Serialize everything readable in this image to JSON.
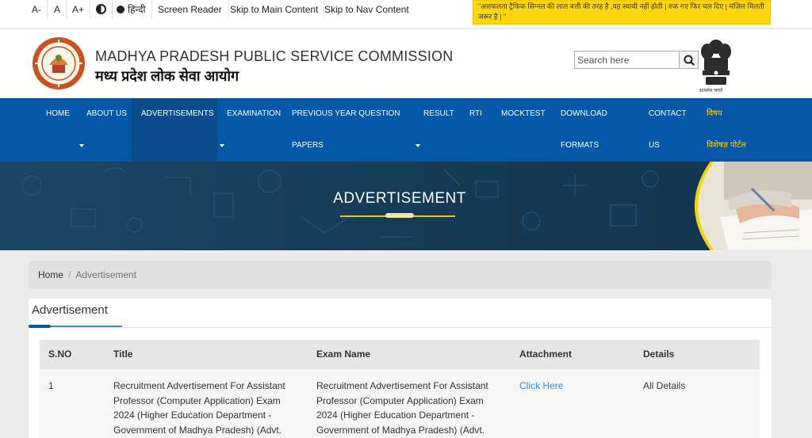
{
  "topbar": {
    "font_smaller": "A-",
    "font_normal": "A",
    "font_larger": "A+",
    "language": "हिन्दी",
    "screen_reader": "Screen Reader",
    "skip_main": "Skip to Main Content",
    "skip_nav": "Skip to Nav Content",
    "quote": "\"असफलता ट्रैफिक सिग्नल की लाल बत्ती की तरह है ,यह स्थायी नहीं होती | रुक गए फिर चल दिए | मंज़िल मिलती जरूर है | \""
  },
  "header": {
    "org_name_en": "MADHYA PRADESH PUBLIC SERVICE COMMISSION",
    "org_name_hi": "मध्य प्रदेश लोक सेवा आयोग",
    "search_placeholder": "Search here",
    "emblem_motto": "सत्यमेव जयते"
  },
  "nav": {
    "items": [
      {
        "line1": "HOME",
        "line2": ""
      },
      {
        "line1": "ABOUT US",
        "line2": ""
      },
      {
        "line1": "ADVERTISEMENTS",
        "line2": ""
      },
      {
        "line1": "EXAMINATION",
        "line2": ""
      },
      {
        "line1": "PREVIOUS YEAR QUESTION",
        "line2": "PAPERS"
      },
      {
        "line1": "RESULT",
        "line2": ""
      },
      {
        "line1": "RTI",
        "line2": ""
      },
      {
        "line1": "MOCKTEST",
        "line2": ""
      },
      {
        "line1": "DOWNLOAD",
        "line2": "FORMATS"
      },
      {
        "line1": "CONTACT",
        "line2": "US"
      },
      {
        "line1": "विषय",
        "line2": "विशेषज्ञ पोर्टल"
      }
    ],
    "active_item": "ADVERTISEMENTS",
    "highlight_color": "#ffd400"
  },
  "banner": {
    "title": "ADVERTISEMENT"
  },
  "breadcrumb": {
    "home": "Home",
    "separator": "/",
    "current": "Advertisement"
  },
  "section": {
    "title": "Advertisement"
  },
  "table": {
    "headers": [
      "S.NO",
      "Title",
      "Exam Name",
      "Attachment",
      "Details"
    ],
    "rows": [
      {
        "sno": "1",
        "title_lines": [
          "Recruitment Advertisement For Assistant",
          "Professor (Computer Application) Exam",
          "2024 (Higher Education Department -",
          "Government of Madhya Pradesh) (Advt."
        ],
        "exam_lines": [
          "Recruitment Advertisement For Assistant",
          "Professor (Computer Application) Exam",
          "2024 (Higher Education Department -",
          "Government of Madhya Pradesh) (Advt."
        ],
        "attachment": "Click Here",
        "details": "All Details"
      }
    ]
  },
  "colors": {
    "nav_bg": "#0557a8",
    "accent_yellow": "#ffd70f",
    "link": "#2a8fd9"
  }
}
